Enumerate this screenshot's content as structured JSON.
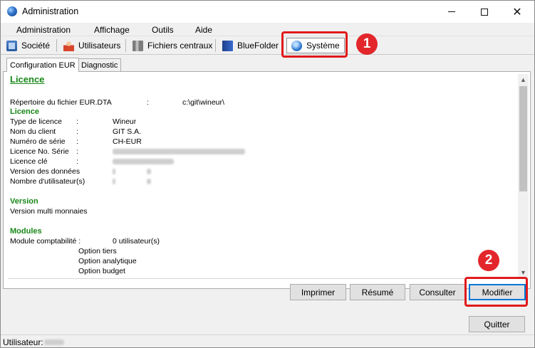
{
  "window": {
    "title": "Administration"
  },
  "menu": [
    "Administration",
    "Affichage",
    "Outils",
    "Aide"
  ],
  "toolbar": {
    "tabs": [
      {
        "label": "Société",
        "icon": "building-icon"
      },
      {
        "label": "Utilisateurs",
        "icon": "users-icon"
      },
      {
        "label": "Fichiers centraux",
        "icon": "files-icon"
      },
      {
        "label": "BlueFolder",
        "icon": "blue-folder-icon"
      },
      {
        "label": "Système",
        "icon": "system-info-icon"
      }
    ],
    "active": "Système"
  },
  "subtabs": [
    "Configuration EUR",
    "Diagnostic"
  ],
  "report": {
    "title": "Licence",
    "file_label": "Répertoire du fichier EUR.DTA",
    "file_sep": ":",
    "file_value": "c:\\git\\wineur\\",
    "licence_head": "Licence",
    "licence_rows": [
      {
        "label": "Type de licence",
        "sep": ":",
        "value": "Wineur"
      },
      {
        "label": "Nom du client",
        "sep": ":",
        "value": "GIT S.A."
      },
      {
        "label": "Numéro de série",
        "sep": ":",
        "value": "CH-EUR"
      },
      {
        "label": "Licence No. Série",
        "sep": ":",
        "value": ""
      },
      {
        "label": "Licence clé",
        "sep": ":",
        "value": ""
      },
      {
        "label": "Version des données",
        "sep": "",
        "value": ""
      },
      {
        "label": "Nombre d'utilisateur(s)",
        "sep": "",
        "value": ""
      }
    ],
    "version_head": "Version",
    "version_text": "Version multi monnaies",
    "modules_head": "Modules",
    "module_label": "Module comptabilité :",
    "module_value": "0  utilisateur(s)",
    "options": [
      "Option tiers",
      "Option analytique",
      "Option budget"
    ]
  },
  "buttons": {
    "print": "Imprimer",
    "summary": "Résumé",
    "consult": "Consulter",
    "modify": "Modifier",
    "quit": "Quitter"
  },
  "status": {
    "user_label": "Utilisateur:"
  },
  "annotations": [
    "1",
    "2"
  ],
  "colors": {
    "section_green": "#188818",
    "annotation_red": "#e11a1a",
    "default_button_blue": "#0078d7"
  }
}
